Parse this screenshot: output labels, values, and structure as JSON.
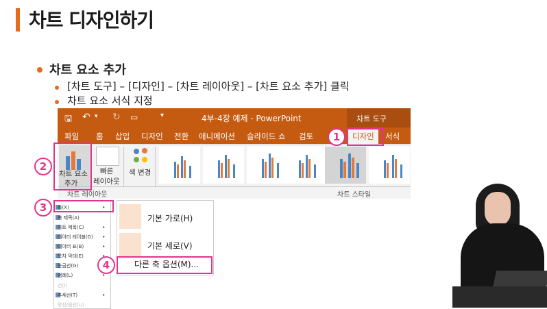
{
  "slide": {
    "title": "차트 디자인하기",
    "bullet1": "차트 요소 추가",
    "bullet2": "[차트 도구] – [디자인] – [차트 레이아웃] – [차트 요소 추가] 클릭",
    "bullet3": "차트 요소 서식 지정"
  },
  "window": {
    "title": "4부-4장 예제 - PowerPoint",
    "context_tool": "차트 도구"
  },
  "tabs": [
    "파일",
    "홈",
    "삽입",
    "디자인",
    "전환",
    "애니메이션",
    "슬라이드 쇼",
    "검토",
    "디자인",
    "서식"
  ],
  "ribbon": {
    "add_element": "차트 요소",
    "add_element2": "추가",
    "quick_layout": "빠른",
    "quick_layout2": "레이아웃",
    "change_color": "색 변경",
    "group_layout": "차트 레이아웃",
    "group_style": "차트 스타일"
  },
  "menu": {
    "items": [
      "축(X)",
      "축 제목(A)",
      "차트 제목(C)",
      "데이터 레이블(D)",
      "데이터 표(B)",
      "오차 막대(E)",
      "눈금선(G)",
      "범례(L)",
      "선(I)",
      "추세선(T)",
      "양선/음선(U)"
    ]
  },
  "submenu": {
    "item1": "기본 가로(H)",
    "item2": "기본 세로(V)",
    "item3": "다른 축 옵션(M)..."
  },
  "annotations": [
    "1",
    "2",
    "3",
    "4"
  ],
  "colors": {
    "accent": "#e86a1e",
    "ppt": "#c55a11",
    "highlight": "#e4338b"
  }
}
